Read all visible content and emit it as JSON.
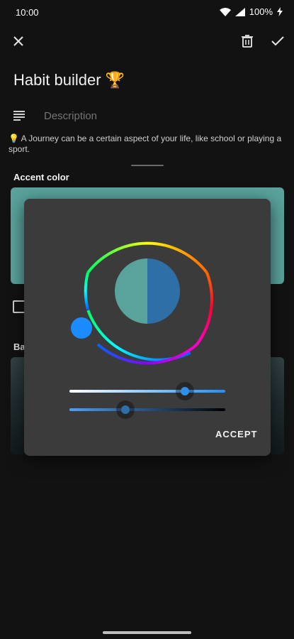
{
  "status_bar": {
    "time": "10:00",
    "battery": "100%"
  },
  "toolbar": {
    "close_icon": "close-icon",
    "delete_icon": "trash-icon",
    "save_icon": "check-icon"
  },
  "journey": {
    "title": "Habit builder 🏆",
    "description_placeholder": "Description",
    "hint": "💡 A Journey can be a certain aspect of your life, like school or playing a sport."
  },
  "accent": {
    "label": "Accent color",
    "color": "#5aa39c"
  },
  "background": {
    "label": "Ba"
  },
  "color_picker": {
    "old_color": "#5aa39c",
    "new_color": "#2f6fa8",
    "hue_handle_color": "#1a8cff",
    "slider_1_value": 0.74,
    "slider_2_value": 0.36,
    "accept_label": "ACCEPT"
  }
}
